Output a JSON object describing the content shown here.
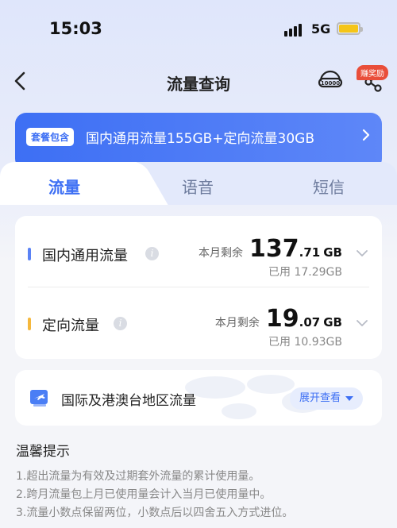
{
  "status_bar": {
    "time": "15:03",
    "network": "5G",
    "battery_color": "#f5c518"
  },
  "nav": {
    "title": "流量查询",
    "reward_badge": "赚奖励",
    "service_icon_text": "10000"
  },
  "banner": {
    "tag": "套餐包含",
    "text": "国内通用流量155GB+定向流量30GB"
  },
  "tabs": [
    {
      "label": "流量",
      "active": true
    },
    {
      "label": "语音",
      "active": false
    },
    {
      "label": "短信",
      "active": false
    }
  ],
  "usage": [
    {
      "label": "国内通用流量",
      "bar_color": "#5a82f5",
      "remain_label": "本月剩余",
      "remain_int": "137",
      "remain_dec": ".71",
      "unit": "GB",
      "used": "已用 17.29GB"
    },
    {
      "label": "定向流量",
      "bar_color": "#f5b83d",
      "remain_label": "本月剩余",
      "remain_int": "19",
      "remain_dec": ".07",
      "unit": "GB",
      "used": "已用 10.93GB"
    }
  ],
  "intl": {
    "label": "国际及港澳台地区流量",
    "button": "展开查看"
  },
  "tips": {
    "title": "温馨提示",
    "items": [
      "1.超出流量为有效及过期套外流量的累计使用量。",
      "2.跨月流量包上月已使用量会计入当月已使用量中。",
      "3.流量小数点保留两位，小数点后以四舍五入方式进位。"
    ]
  },
  "colors": {
    "accent": "#3d6ff4",
    "badge": "#e94e3a"
  }
}
